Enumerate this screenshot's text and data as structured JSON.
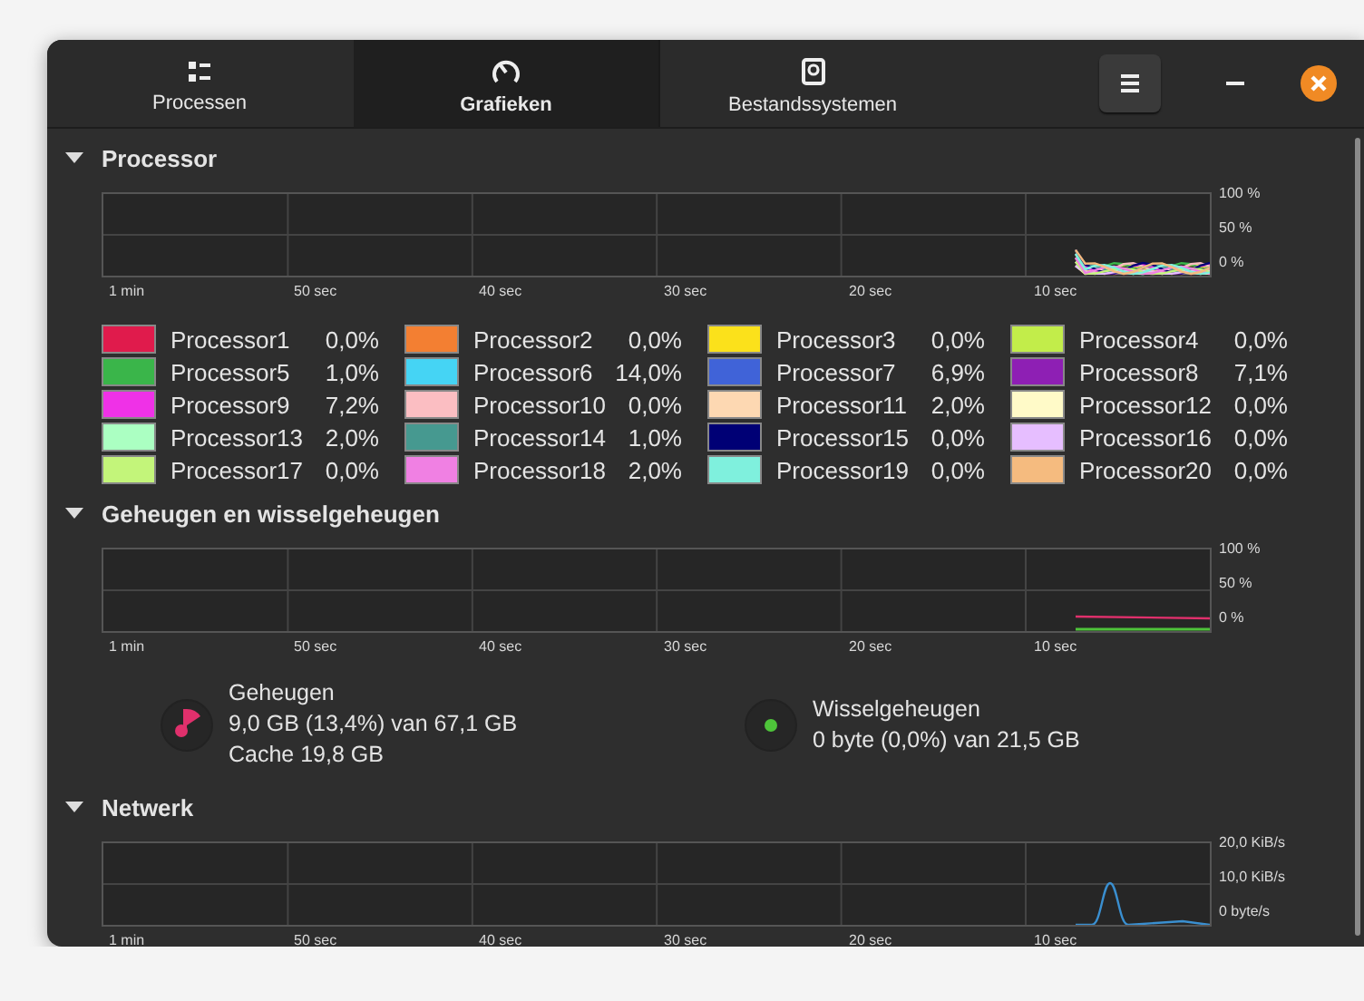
{
  "tabs": [
    {
      "label": "Processen",
      "selected": false
    },
    {
      "label": "Grafieken",
      "selected": true
    },
    {
      "label": "Bestandssystemen",
      "selected": false
    }
  ],
  "sections": [
    {
      "kind": "cpu",
      "title": "Processor",
      "expanded": true,
      "chart": {
        "y_labels": [
          "100 %",
          "50 %",
          "0 %"
        ],
        "x_labels": [
          "1 min",
          "50 sec",
          "40 sec",
          "30 sec",
          "20 sec",
          "10 sec"
        ]
      },
      "legend": [
        {
          "name": "Processor1",
          "value": "0,0%",
          "color": "#e01b4c"
        },
        {
          "name": "Processor2",
          "value": "0,0%",
          "color": "#f37f32"
        },
        {
          "name": "Processor3",
          "value": "0,0%",
          "color": "#fbe11b"
        },
        {
          "name": "Processor4",
          "value": "0,0%",
          "color": "#c2ed4a"
        },
        {
          "name": "Processor5",
          "value": "1,0%",
          "color": "#3ab54a"
        },
        {
          "name": "Processor6",
          "value": "14,0%",
          "color": "#45d4f4"
        },
        {
          "name": "Processor7",
          "value": "6,9%",
          "color": "#4063d8"
        },
        {
          "name": "Processor8",
          "value": "7,1%",
          "color": "#8e1fb4"
        },
        {
          "name": "Processor9",
          "value": "7,2%",
          "color": "#ef31e7"
        },
        {
          "name": "Processor10",
          "value": "0,0%",
          "color": "#fbbec2"
        },
        {
          "name": "Processor11",
          "value": "2,0%",
          "color": "#fdd8b2"
        },
        {
          "name": "Processor12",
          "value": "0,0%",
          "color": "#fffac8"
        },
        {
          "name": "Processor13",
          "value": "2,0%",
          "color": "#abffc2"
        },
        {
          "name": "Processor14",
          "value": "1,0%",
          "color": "#469990"
        },
        {
          "name": "Processor15",
          "value": "0,0%",
          "color": "#000075"
        },
        {
          "name": "Processor16",
          "value": "0,0%",
          "color": "#e6beff"
        },
        {
          "name": "Processor17",
          "value": "0,0%",
          "color": "#c3f57a"
        },
        {
          "name": "Processor18",
          "value": "2,0%",
          "color": "#f080e3"
        },
        {
          "name": "Processor19",
          "value": "0,0%",
          "color": "#7ff0dd"
        },
        {
          "name": "Processor20",
          "value": "0,0%",
          "color": "#f5bb7f"
        }
      ]
    },
    {
      "kind": "memory",
      "title": "Geheugen en wisselgeheugen",
      "expanded": true,
      "chart": {
        "y_labels": [
          "100 %",
          "50 %",
          "0 %"
        ],
        "x_labels": [
          "1 min",
          "50 sec",
          "40 sec",
          "30 sec",
          "20 sec",
          "10 sec"
        ]
      },
      "gauges": [
        {
          "kind": "pie",
          "title": "Geheugen",
          "color": "#e0306c",
          "lines": [
            "9,0 GB (13,4%) van 67,1 GB",
            "Cache 19,8 GB"
          ]
        },
        {
          "kind": "dot",
          "title": "Wisselgeheugen",
          "color": "#4ec43a",
          "lines": [
            "0 byte (0,0%) van 21,5 GB"
          ]
        }
      ]
    },
    {
      "kind": "network",
      "title": "Netwerk",
      "expanded": true,
      "chart": {
        "y_labels": [
          "20,0 KiB/s",
          "10,0 KiB/s",
          "0 byte/s"
        ],
        "x_labels": [
          "1 min",
          "50 sec",
          "40 sec",
          "30 sec",
          "20 sec",
          "10 sec"
        ]
      }
    }
  ]
}
